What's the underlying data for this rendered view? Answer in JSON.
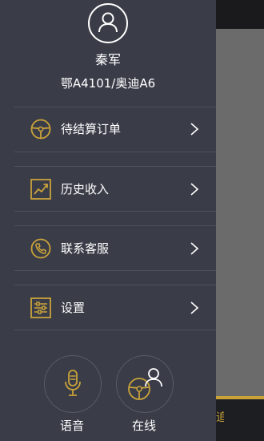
{
  "background": {
    "tab_char_partial": "追"
  },
  "profile": {
    "name": "秦军",
    "plate": "鄂A4101/奥迪A6"
  },
  "menu": [
    {
      "label": "待结算订单",
      "icon": "steering-wheel-icon"
    },
    {
      "label": "历史收入",
      "icon": "trend-chart-icon"
    },
    {
      "label": "联系客服",
      "icon": "phone-icon"
    },
    {
      "label": "设置",
      "icon": "settings-sliders-icon"
    }
  ],
  "bottom": {
    "voice_label": "语音",
    "online_label": "在线"
  },
  "colors": {
    "drawer_bg": "#3a3d48",
    "accent": "#c9a23a",
    "text": "#ffffff",
    "divider": "#4f525c"
  }
}
